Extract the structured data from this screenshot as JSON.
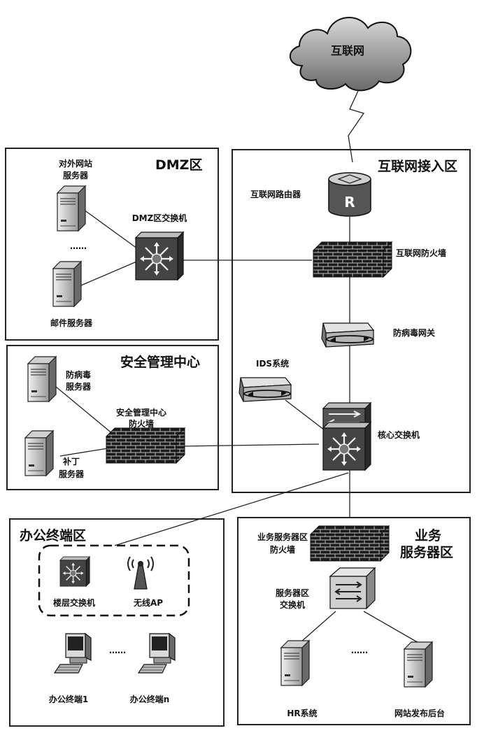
{
  "internet": "互联网",
  "zones": {
    "dmz": "DMZ区",
    "access": "互联网接入区",
    "security": "安全管理中心",
    "office": "办公终端区",
    "business_l1": "业务",
    "business_l2": "服务器区"
  },
  "labels": {
    "web_server_l1": "对外网站",
    "web_server_l2": "服务器",
    "dmz_ellipsis": "……",
    "mail_server": "邮件服务器",
    "dmz_switch": "DMZ区交换机",
    "router": "互联网路由器",
    "router_letter": "R",
    "internet_fw": "互联网防火墙",
    "av_gateway": "防病毒网关",
    "ids": "IDS系统",
    "core_switch": "核心交换机",
    "av_server_l1": "防病毒",
    "av_server_l2": "服务器",
    "smc_fw_l1": "安全管理中心",
    "smc_fw_l2": "防火墙",
    "patch_l1": "补丁",
    "patch_l2": "服务器",
    "floor_switch": "楼层交换机",
    "wireless_ap": "无线AP",
    "office_ellipsis": "……",
    "terminal_1": "办公终端1",
    "terminal_n": "办公终端n",
    "biz_fw_l1": "业务服务器区",
    "biz_fw_l2": "防火墙",
    "server_switch_l1": "服务器区",
    "server_switch_l2": "交换机",
    "biz_ellipsis": "……",
    "hr_system": "HR系统",
    "web_publish": "网站发布后台"
  }
}
